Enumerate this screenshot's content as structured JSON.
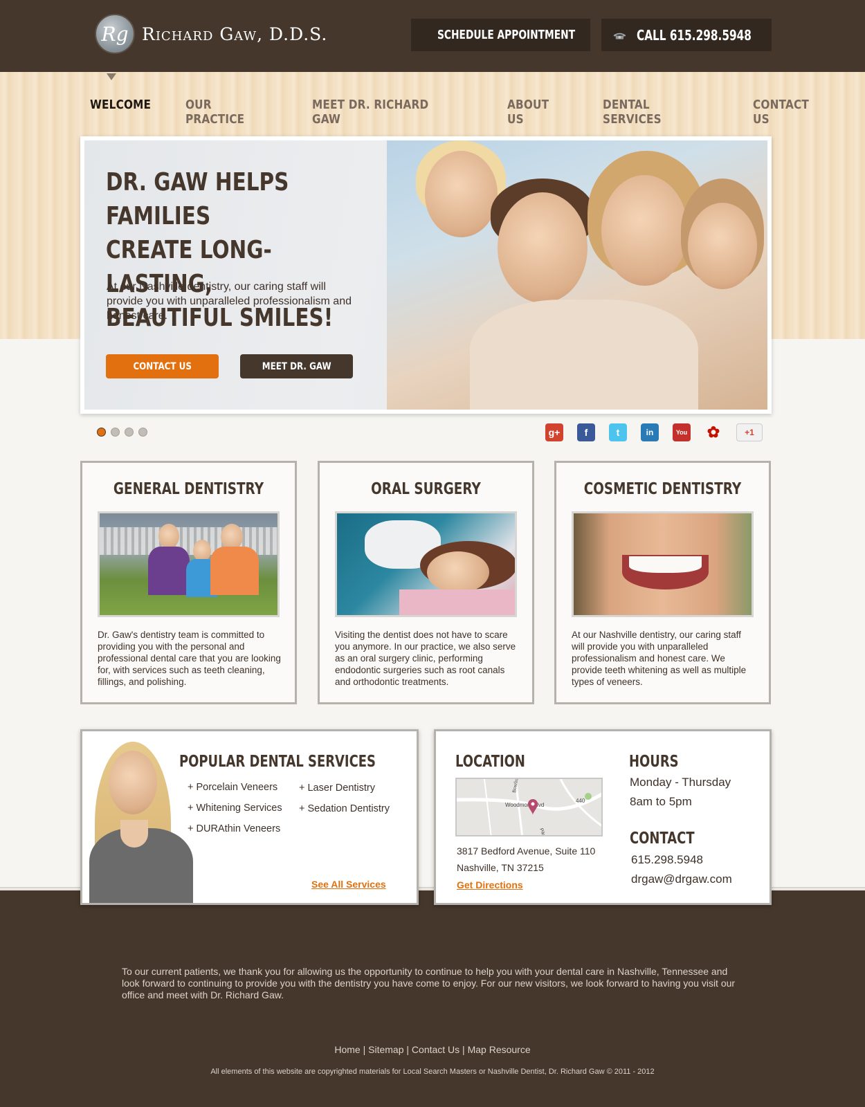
{
  "brand": {
    "logo_initials": "Rg",
    "name": "Richard Gaw, D.D.S."
  },
  "header": {
    "schedule_label": "SCHEDULE APPOINTMENT",
    "call_prefix": "CALL",
    "call_number": "615.298.5948"
  },
  "nav": [
    {
      "label": "WELCOME",
      "active": true
    },
    {
      "label": "OUR PRACTICE"
    },
    {
      "label": "MEET DR. RICHARD GAW"
    },
    {
      "label": "ABOUT US"
    },
    {
      "label": "DENTAL SERVICES"
    },
    {
      "label": "CONTACT US"
    }
  ],
  "hero": {
    "title_line1": "DR. GAW HELPS FAMILIES",
    "title_line2": "CREATE LONG-LASTING,",
    "title_line3": "BEAUTIFUL SMILES!",
    "text": "At our Nashville dentistry, our caring staff will provide you with unparalleled professionalism and honest care.",
    "btn_contact": "CONTACT US",
    "btn_meet": "MEET DR. GAW"
  },
  "social": [
    "google-plus",
    "facebook",
    "twitter",
    "linkedin",
    "youtube",
    "yelp",
    "google-plus-one"
  ],
  "social_glyphs": {
    "gp": "g+",
    "fb": "f",
    "tw": "t",
    "li": "in",
    "yt": "You",
    "ye": "✿",
    "g1": "+1"
  },
  "cards": [
    {
      "title": "GENERAL DENTISTRY",
      "text": "Dr. Gaw's dentistry team is committed to providing you with the personal and professional dental care that you are looking for, with services such as teeth cleaning, fillings, and polishing."
    },
    {
      "title": "ORAL SURGERY",
      "text": "Visiting the dentist does not have to scare you anymore. In our practice, we also serve as an oral surgery clinic, performing endodontic surgeries such as root canals and orthodontic treatments."
    },
    {
      "title": "COSMETIC DENTISTRY",
      "text": "At our Nashville dentistry, our caring staff will provide you with unparalleled professionalism and honest care. We provide teeth whitening as well as multiple types of veneers."
    }
  ],
  "services": {
    "title": "POPULAR DENTAL SERVICES",
    "col1": [
      "+ Porcelain Veneers",
      "+ Whitening Services",
      "+ DURAthin Veneers"
    ],
    "col2": [
      "+ Laser Dentistry",
      "+ Sedation Dentistry"
    ],
    "link": "See All Services"
  },
  "location": {
    "title": "LOCATION",
    "map_labels": {
      "street1": "Bowlin",
      "street2": "Woodmont Blvd",
      "road": "440",
      "street3": "Pike"
    },
    "address1": "3817 Bedford Avenue, Suite 110",
    "address2": "Nashville, TN 37215",
    "directions": "Get Directions"
  },
  "hours": {
    "title": "HOURS",
    "days": "Monday - Thursday",
    "time": "8am to 5pm"
  },
  "contact": {
    "title": "CONTACT",
    "phone": "615.298.5948",
    "email": "drgaw@drgaw.com"
  },
  "footer": {
    "text": "To our current patients, we thank you for allowing us the opportunity to continue to help you with your dental care in Nashville, Tennessee and look forward to continuing to provide you with the dentistry you have come to enjoy. For our new visitors, we look forward to having you visit our office and meet with Dr. Richard Gaw.",
    "links": [
      "Home",
      "Sitemap",
      "Contact Us",
      "Map Resource"
    ],
    "copyright": "All elements of this website are copyrighted materials for Local Search Masters or Nashville Dentist, Dr. Richard Gaw © 2011 - 2012"
  },
  "colors": {
    "brown": "#45372c",
    "orange": "#e2700e",
    "wood": "#f3e0c4"
  }
}
